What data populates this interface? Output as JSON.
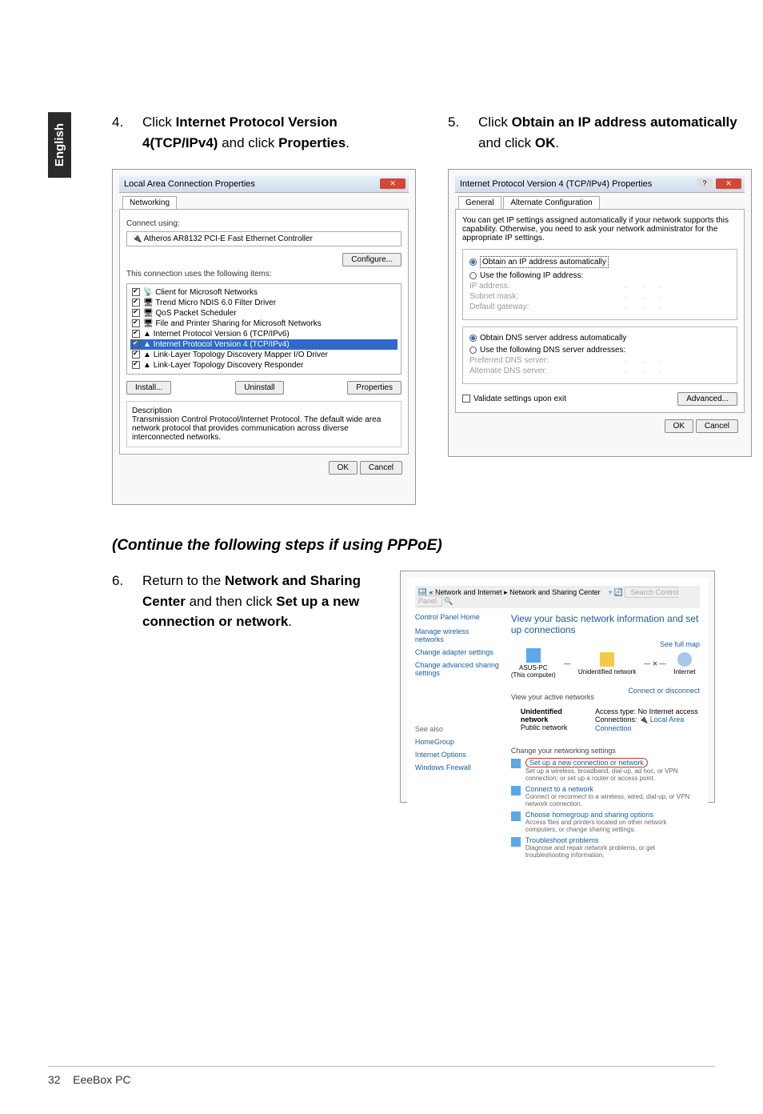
{
  "page": {
    "langTab": "English",
    "footer": {
      "pageNum": "32",
      "product": "EeeBox PC"
    }
  },
  "step4": {
    "num": "4.",
    "pre": "Click ",
    "b1": "Internet Protocol Version 4(TCP/IPv4)",
    "mid": " and click ",
    "b2": "Properties",
    "post": "."
  },
  "step5": {
    "num": "5.",
    "pre": "Click ",
    "b1": "Obtain an IP address automatically",
    "mid": " and click ",
    "b2": "OK",
    "post": "."
  },
  "continueHeading": "(Continue the following steps if using PPPoE)",
  "step6": {
    "num": "6.",
    "t1": "Return to the ",
    "b1": "Network and Sharing Center",
    "t2": " and then click ",
    "b2": "Set up a new connection or network",
    "t3": "."
  },
  "lac": {
    "title": "Local Area Connection Properties",
    "tab": "Networking",
    "connectUsing": "Connect using:",
    "adapter": "Atheros AR8132 PCI-E Fast Ethernet Controller",
    "configure": "Configure...",
    "itemsLabel": "This connection uses the following items:",
    "items": [
      "Client for Microsoft Networks",
      "Trend Micro NDIS 6.0 Filter Driver",
      "QoS Packet Scheduler",
      "File and Printer Sharing for Microsoft Networks",
      "Internet Protocol Version 6 (TCP/IPv6)",
      "Internet Protocol Version 4 (TCP/IPv4)",
      "Link-Layer Topology Discovery Mapper I/O Driver",
      "Link-Layer Topology Discovery Responder"
    ],
    "install": "Install...",
    "uninstall": "Uninstall",
    "properties": "Properties",
    "descHead": "Description",
    "descBody": "Transmission Control Protocol/Internet Protocol. The default wide area network protocol that provides communication across diverse interconnected networks.",
    "ok": "OK",
    "cancel": "Cancel"
  },
  "ipv4": {
    "title": "Internet Protocol Version 4 (TCP/IPv4) Properties",
    "tab1": "General",
    "tab2": "Alternate Configuration",
    "intro": "You can get IP settings assigned automatically if your network supports this capability. Otherwise, you need to ask your network administrator for the appropriate IP settings.",
    "r1": "Obtain an IP address automatically",
    "r2": "Use the following IP address:",
    "ipAddr": "IP address:",
    "subnet": "Subnet mask:",
    "gateway": "Default gateway:",
    "r3": "Obtain DNS server address automatically",
    "r4": "Use the following DNS server addresses:",
    "pdns": "Preferred DNS server:",
    "adns": "Alternate DNS server:",
    "validate": "Validate settings upon exit",
    "advanced": "Advanced...",
    "ok": "OK",
    "cancel": "Cancel"
  },
  "ns": {
    "path": "« Network and Internet ▸ Network and Sharing Center",
    "search": "Search Control Panel",
    "leftHome": "Control Panel Home",
    "leftLinks": [
      "Manage wireless networks",
      "Change adapter settings",
      "Change advanced sharing settings"
    ],
    "seeAlso": "See also",
    "seeAlsoLinks": [
      "HomeGroup",
      "Internet Options",
      "Windows Firewall"
    ],
    "heading": "View your basic network information and set up connections",
    "fullMap": "See full map",
    "node1": "ASUS-PC",
    "node1sub": "(This computer)",
    "node2": "Unidentified network",
    "node3": "Internet",
    "activeHead": "View your active networks",
    "connectDisc": "Connect or disconnect",
    "netName": "Unidentified network",
    "netType": "Public network",
    "accessLbl": "Access type:",
    "accessVal": "No Internet access",
    "connLbl": "Connections:",
    "connVal": "Local Area Connection",
    "changeHead": "Change your networking settings",
    "opts": [
      {
        "title": "Set up a new connection or network",
        "sub": "Set up a wireless, broadband, dial-up, ad hoc, or VPN connection; or set up a router or access point.",
        "circled": true
      },
      {
        "title": "Connect to a network",
        "sub": "Connect or reconnect to a wireless, wired, dial-up, or VPN network connection."
      },
      {
        "title": "Choose homegroup and sharing options",
        "sub": "Access files and printers located on other network computers, or change sharing settings."
      },
      {
        "title": "Troubleshoot problems",
        "sub": "Diagnose and repair network problems, or get troubleshooting information."
      }
    ]
  }
}
